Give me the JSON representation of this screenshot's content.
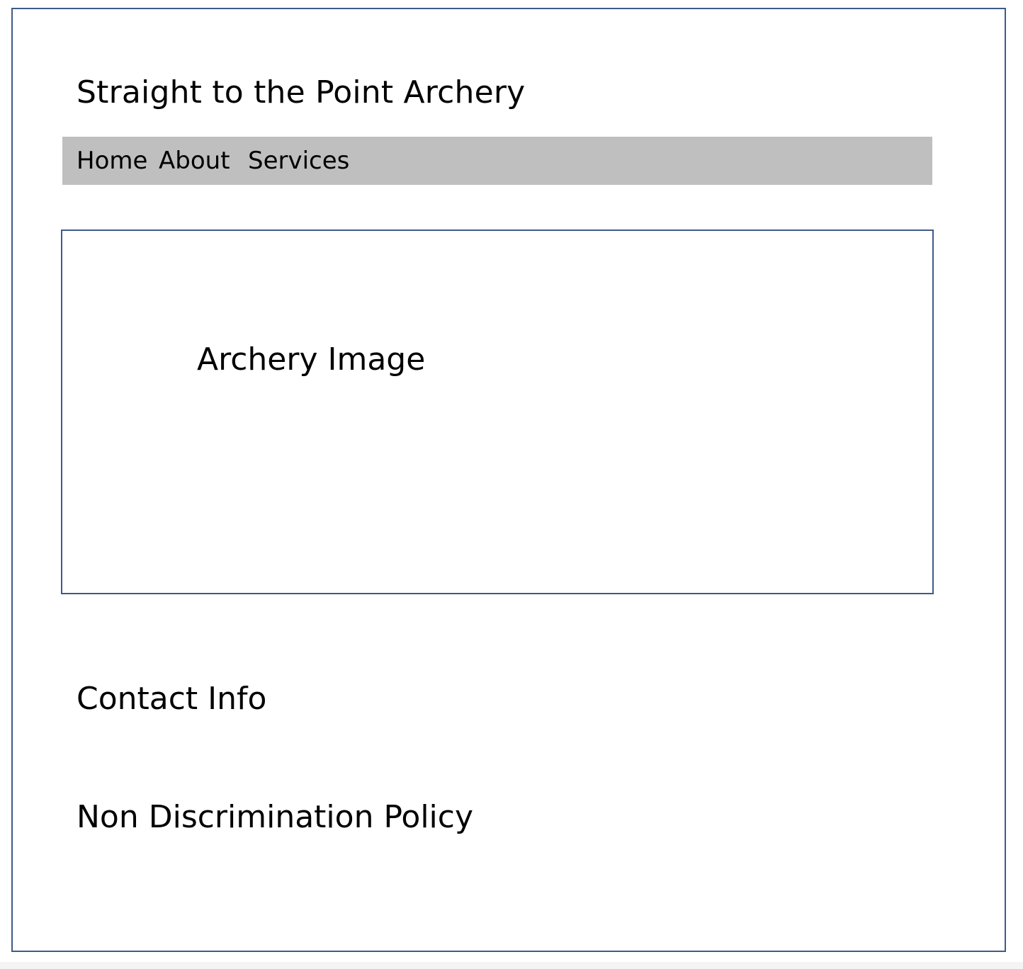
{
  "header": {
    "title": "Straight to the Point Archery"
  },
  "nav": {
    "items": [
      {
        "label": "Home"
      },
      {
        "label": "About"
      },
      {
        "label": "Services"
      }
    ]
  },
  "hero": {
    "image_placeholder_label": "Archery Image"
  },
  "footer": {
    "contact_label": "Contact Info",
    "policy_label": "Non Discrimination Policy"
  },
  "colors": {
    "frame_border": "#3f5a8a",
    "nav_background": "#bfbfbf",
    "page_background": "#ffffff",
    "text": "#000000"
  }
}
